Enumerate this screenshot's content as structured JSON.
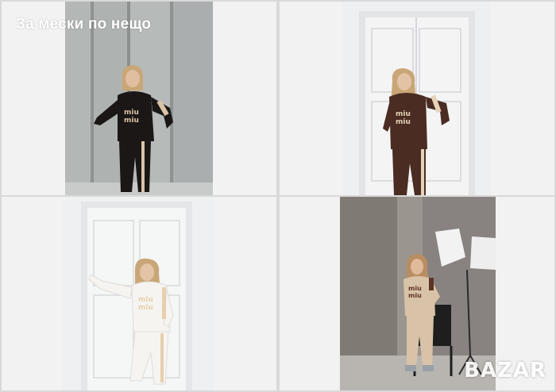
{
  "gallery": {
    "caption": "За мески по нещо",
    "watermark": "BAZAR",
    "photos": [
      {
        "alt": "black tracksuit model",
        "accent": "#1b1716",
        "trim": "#d9c4a6"
      },
      {
        "alt": "brown tracksuit model",
        "accent": "#4a2c22",
        "trim": "#e7d2b8"
      },
      {
        "alt": "white tracksuit model",
        "accent": "#f6f4f1",
        "trim": "#e6cfae"
      },
      {
        "alt": "beige tracksuit model",
        "accent": "#d8c3a8",
        "trim": "#5b3427"
      }
    ]
  }
}
